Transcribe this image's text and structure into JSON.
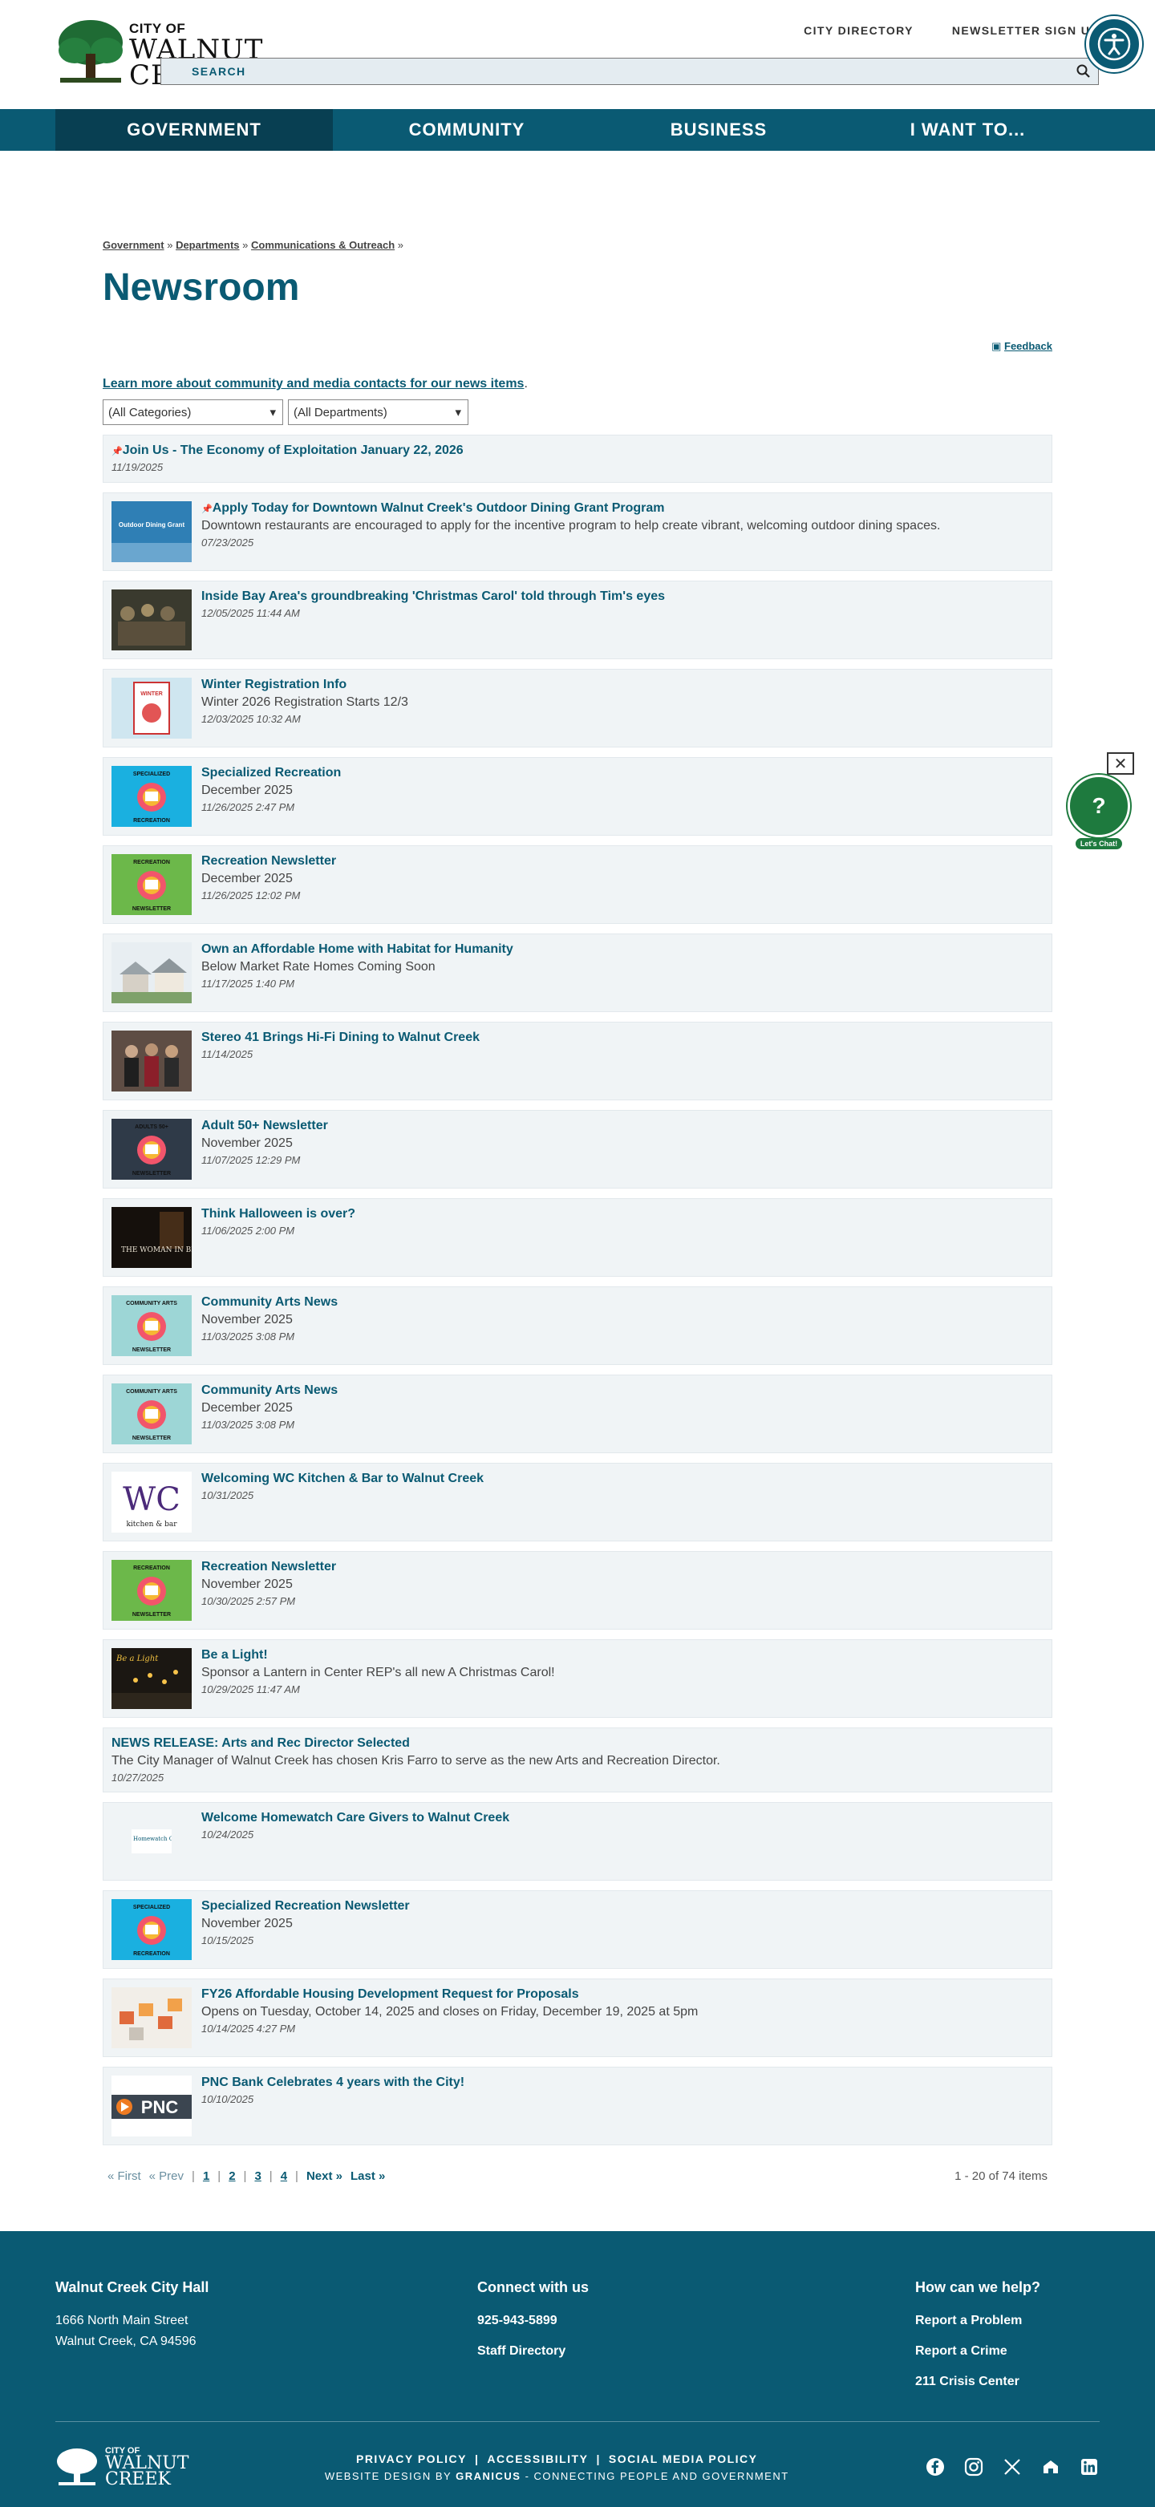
{
  "header": {
    "logo": {
      "line1": "CITY OF",
      "line2": "WALNUT",
      "line3": "CREEK"
    },
    "util_links": [
      "CITY DIRECTORY",
      "NEWSLETTER SIGN UP"
    ],
    "search_label": "SEARCH"
  },
  "nav": {
    "items": [
      {
        "label": "GOVERNMENT",
        "active": true
      },
      {
        "label": "COMMUNITY",
        "active": false
      },
      {
        "label": "BUSINESS",
        "active": false
      },
      {
        "label": "I WANT TO...",
        "active": false
      }
    ]
  },
  "breadcrumb": {
    "items": [
      "Government",
      "Departments",
      "Communications & Outreach"
    ],
    "sep": "»"
  },
  "page_title": "Newsroom",
  "feedback_label": "Feedback",
  "intro_link": "Learn more about community and media contacts for our news items",
  "filters": {
    "categories": "(All Categories)",
    "departments": "(All Departments)"
  },
  "news": [
    {
      "pinned": true,
      "title": "Join Us - The Economy of Exploitation January 22, 2026",
      "desc": "",
      "date": "11/19/2025",
      "thumb": "none"
    },
    {
      "pinned": true,
      "title": "Apply Today for Downtown Walnut Creek's Outdoor Dining Grant Program",
      "desc": "Downtown restaurants are encouraged to apply for the incentive program to help create vibrant, welcoming outdoor dining spaces.",
      "date": "07/23/2025",
      "thumb": "dining"
    },
    {
      "pinned": false,
      "title": "Inside Bay Area's groundbreaking 'Christmas Carol' told through Tim's eyes",
      "desc": "",
      "date": "12/05/2025 11:44 AM",
      "thumb": "photo-dark"
    },
    {
      "pinned": false,
      "title": "Winter Registration Info",
      "desc": "Winter 2026 Registration Starts 12/3",
      "date": "12/03/2025 10:32 AM",
      "thumb": "winter"
    },
    {
      "pinned": false,
      "title": "Specialized Recreation",
      "desc": "December 2025",
      "date": "11/26/2025 2:47 PM",
      "thumb": "specialized"
    },
    {
      "pinned": false,
      "title": "Recreation Newsletter",
      "desc": "December 2025",
      "date": "11/26/2025 12:02 PM",
      "thumb": "recreation"
    },
    {
      "pinned": false,
      "title": "Own an Affordable Home with Habitat for Humanity",
      "desc": "Below Market Rate Homes Coming Soon",
      "date": "11/17/2025 1:40 PM",
      "thumb": "houses"
    },
    {
      "pinned": false,
      "title": "Stereo 41 Brings Hi-Fi Dining to Walnut Creek",
      "desc": "",
      "date": "11/14/2025",
      "thumb": "photo-people"
    },
    {
      "pinned": false,
      "title": "Adult 50+ Newsletter",
      "desc": "November 2025",
      "date": "11/07/2025 12:29 PM",
      "thumb": "adults"
    },
    {
      "pinned": false,
      "title": "Think Halloween is over?",
      "desc": "",
      "date": "11/06/2025 2:00 PM",
      "thumb": "woman"
    },
    {
      "pinned": false,
      "title": "Community Arts News",
      "desc": "November 2025",
      "date": "11/03/2025 3:08 PM",
      "thumb": "arts"
    },
    {
      "pinned": false,
      "title": "Community Arts News",
      "desc": "December 2025",
      "date": "11/03/2025 3:08 PM",
      "thumb": "arts"
    },
    {
      "pinned": false,
      "title": "Welcoming WC Kitchen & Bar to Walnut Creek",
      "desc": "",
      "date": "10/31/2025",
      "thumb": "wc"
    },
    {
      "pinned": false,
      "title": "Recreation Newsletter",
      "desc": "November 2025",
      "date": "10/30/2025 2:57 PM",
      "thumb": "recreation"
    },
    {
      "pinned": false,
      "title": "Be a Light!",
      "desc": "Sponsor a Lantern in Center REP's all new A Christmas Carol!",
      "date": "10/29/2025 11:47 AM",
      "thumb": "light"
    },
    {
      "pinned": false,
      "title": "NEWS RELEASE: Arts and Rec Director Selected",
      "desc": "The City Manager of Walnut Creek has chosen Kris Farro to serve as the new Arts and Recreation Director.",
      "date": "10/27/2025",
      "thumb": "none"
    },
    {
      "pinned": false,
      "title": "Welcome Homewatch Care Givers to Walnut Creek",
      "desc": "",
      "date": "10/24/2025",
      "thumb": "homewatch"
    },
    {
      "pinned": false,
      "title": "Specialized Recreation Newsletter",
      "desc": "November 2025",
      "date": "10/15/2025",
      "thumb": "specialized"
    },
    {
      "pinned": false,
      "title": "FY26 Affordable Housing Development Request for Proposals",
      "desc": "Opens on Tuesday, October 14, 2025 and closes on Friday, December 19, 2025 at 5pm",
      "date": "10/14/2025 4:27 PM",
      "thumb": "blocks"
    },
    {
      "pinned": false,
      "title": "PNC Bank Celebrates 4 years with the City!",
      "desc": "",
      "date": "10/10/2025",
      "thumb": "pnc"
    }
  ],
  "thumb_text": {
    "dining": "Outdoor Dining Grant",
    "specialized_top": "SPECIALIZED",
    "specialized_bottom": "RECREATION",
    "recreation_top": "RECREATION",
    "newsletter": "NEWSLETTER",
    "adults_top": "ADULTS 50+",
    "arts_top": "COMMUNITY ARTS",
    "woman": "THE WOMAN IN BLACK",
    "wc": "WC",
    "wc_sub": "kitchen & bar",
    "light": "Be a Light",
    "homewatch": "Homewatch CareGivers",
    "pnc": "PNC",
    "winter": "WINTER"
  },
  "pager": {
    "first": "« First",
    "prev": "« Prev",
    "pages": [
      "1",
      "2",
      "3",
      "4"
    ],
    "next": "Next »",
    "last": "Last »",
    "count": "1 - 20 of 74 items"
  },
  "chat": {
    "label": "Let's Chat!",
    "close": "✕"
  },
  "footer": {
    "col1": {
      "title": "Walnut Creek City Hall",
      "line1": "1666 North Main Street",
      "line2": "Walnut Creek, CA 94596"
    },
    "col2": {
      "title": "Connect with us",
      "phone": "925-943-5899",
      "link": "Staff Directory"
    },
    "col3": {
      "title": "How can we help?",
      "links": [
        "Report a Problem",
        "Report a Crime",
        "211 Crisis Center"
      ]
    },
    "logo": {
      "line1": "CITY OF",
      "line2": "WALNUT",
      "line3": "CREEK"
    },
    "bottom_links": [
      "PRIVACY POLICY",
      "ACCESSIBILITY",
      "SOCIAL MEDIA POLICY"
    ],
    "credit_prefix": "WEBSITE DESIGN BY ",
    "credit_brand": "GRANICUS",
    "credit_suffix": " - CONNECTING PEOPLE AND GOVERNMENT",
    "social": [
      "facebook-icon",
      "instagram-icon",
      "x-icon",
      "nextdoor-icon",
      "linkedin-icon"
    ]
  },
  "colors": {
    "brand": "#0a5a73",
    "nav_active": "#083f52",
    "chat": "#1e7a3e",
    "item_bg": "#f0f4f6"
  }
}
